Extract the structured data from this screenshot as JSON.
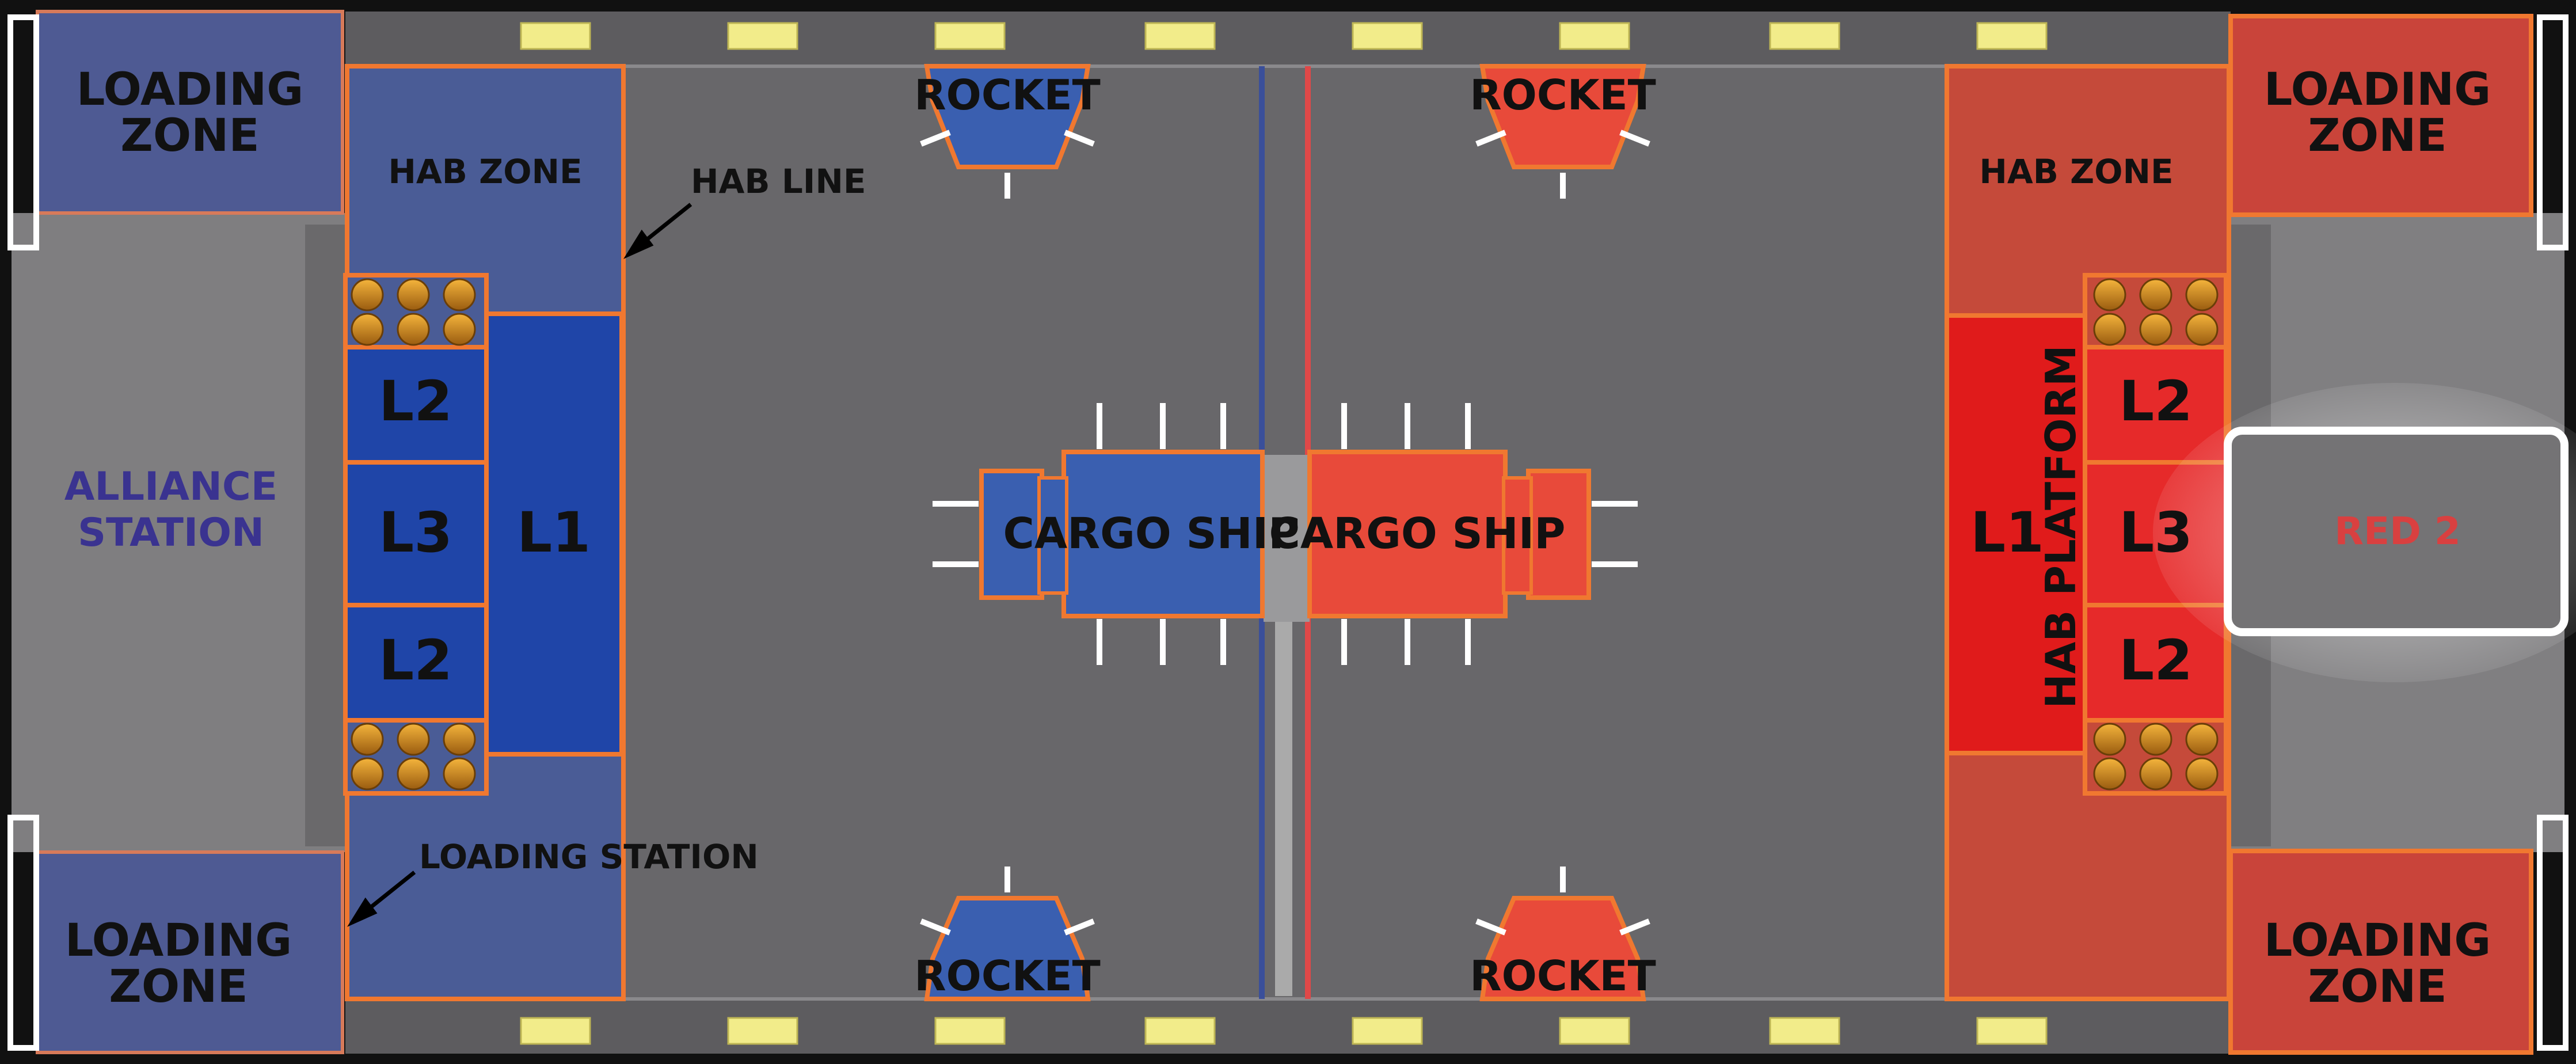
{
  "labels": {
    "loading_zone_line1": "LOADING",
    "loading_zone_line2": "ZONE",
    "hab_zone": "HAB ZONE",
    "hab_line": "HAB LINE",
    "loading_station": "LOADING STATION",
    "alliance_station_line1": "ALLIANCE",
    "alliance_station_line2": "STATION",
    "rocket": "ROCKET",
    "cargo_ship": "CARGO SHIP",
    "level_1": "L1",
    "level_2": "L2",
    "level_3": "L3",
    "hab_platform": "HAB PLATFORM",
    "red_2": "RED 2"
  },
  "colors": {
    "blue_alliance": "#3a4f9a",
    "blue_platform": "#1f45a8",
    "red_alliance": "#c9443a",
    "red_platform": "#e01b1b",
    "field_carpet": "#68676a",
    "border_orange": "#f07830",
    "alliance_text": "#3a3390",
    "red2_text": "#d94040"
  }
}
